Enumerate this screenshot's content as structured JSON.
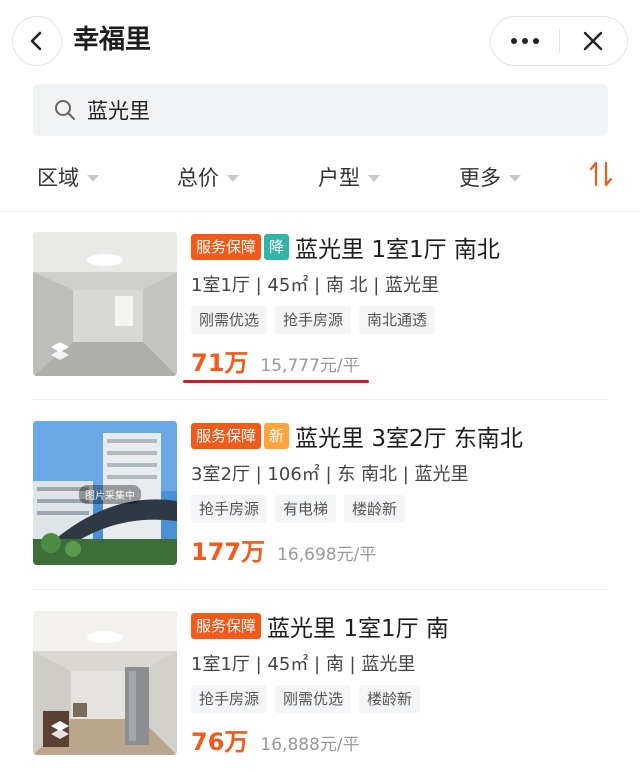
{
  "header": {
    "title": "幸福里",
    "back_icon": "chevron-left-icon",
    "more_icon": "more-dots-icon",
    "close_icon": "close-icon"
  },
  "search": {
    "value": "蓝光里",
    "icon": "search-icon"
  },
  "filters": [
    {
      "label": "区域"
    },
    {
      "label": "总价"
    },
    {
      "label": "户型"
    },
    {
      "label": "更多"
    }
  ],
  "sort_icon": "sort-arrows-icon",
  "colors": {
    "accent": "#f05a1a",
    "teal_badge": "#33b4a5",
    "new_badge": "#ffa43b",
    "underline": "#c8202a"
  },
  "listings": [
    {
      "badges": [
        "服务保障",
        "降"
      ],
      "title": "蓝光里 1室1厅 南北",
      "meta": "1室1厅 | 45㎡ | 南 北 | 蓝光里",
      "tags": [
        "刚需优选",
        "抢手房源",
        "南北通透"
      ],
      "price": "71万",
      "unit_price": "15,777元/平"
    },
    {
      "badges": [
        "服务保障",
        "新"
      ],
      "title": "蓝光里 3室2厅 东南北",
      "meta": "3室2厅 | 106㎡ | 东 南北 | 蓝光里",
      "tags": [
        "抢手房源",
        "有电梯",
        "楼龄新"
      ],
      "price": "177万",
      "unit_price": "16,698元/平",
      "image_caption": "图片采集中"
    },
    {
      "badges": [
        "服务保障"
      ],
      "title": "蓝光里 1室1厅 南",
      "meta": "1室1厅 | 45㎡ | 南 | 蓝光里",
      "tags": [
        "抢手房源",
        "刚需优选",
        "楼龄新"
      ],
      "price": "76万",
      "unit_price": "16,888元/平"
    }
  ]
}
